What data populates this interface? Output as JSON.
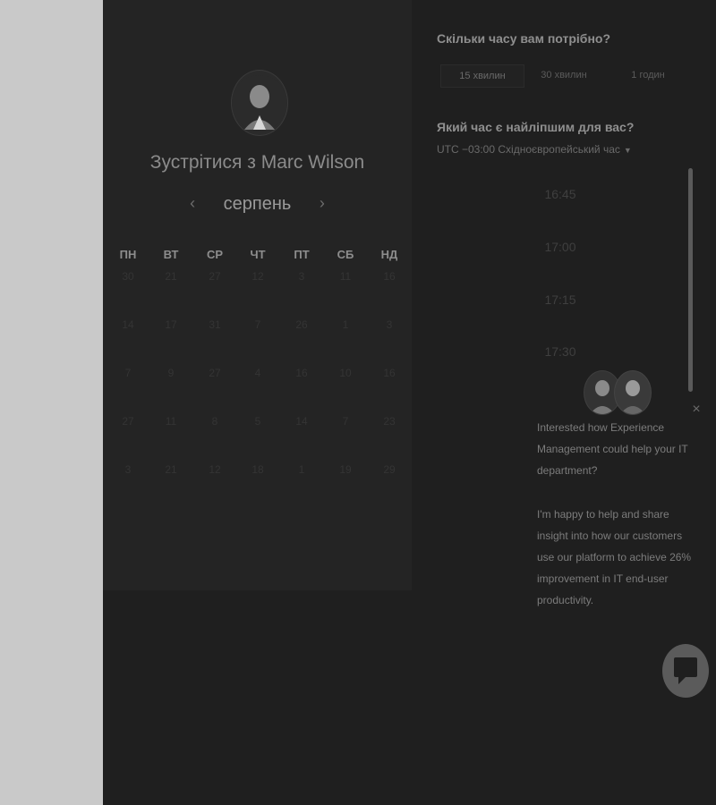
{
  "scheduler": {
    "title": "Зустрітися з Marc Wilson",
    "month": {
      "prev_icon": "‹",
      "label": "серпень",
      "next_icon": "›"
    },
    "weekdays": [
      "ПН",
      "ВТ",
      "СР",
      "ЧТ",
      "ПТ",
      "СБ",
      "НД"
    ],
    "weeks": [
      [
        "30",
        "21",
        "27",
        "12",
        "3",
        "11",
        "16"
      ],
      [
        "14",
        "17",
        "31",
        "7",
        "26",
        "1",
        "3"
      ],
      [
        "7",
        "9",
        "27",
        "4",
        "16",
        "10",
        "16"
      ],
      [
        "27",
        "11",
        "8",
        "5",
        "14",
        "7",
        "23"
      ],
      [
        "3",
        "21",
        "12",
        "18",
        "1",
        "19",
        "29"
      ]
    ]
  },
  "duration": {
    "question": "Скільки часу вам потрібно?",
    "options": [
      "15 хвилин",
      "30 хвилин",
      "1 годин"
    ],
    "selected": "15 хвилин"
  },
  "time": {
    "question": "Який час є найліпшим для вас?",
    "timezone": "UTC −03:00 Східноєвропейський час",
    "slots": [
      "16:45",
      "17:00",
      "17:15",
      "17:30"
    ]
  },
  "chat": {
    "close_icon": "×",
    "message_1": "Interested how Experience Management could help your IT department?",
    "message_2": "I'm happy to help and share insight into how our customers use our platform to achieve 26% improvement in IT end-user productivity."
  },
  "colors": {
    "page_bg": "#1f1f1f",
    "calendar_bg": "#242424",
    "side_bg": "#c9c9c9"
  },
  "icons": {
    "prev": "chevron-left-icon",
    "next": "chevron-right-icon",
    "caret": "caret-down-icon",
    "close": "close-icon",
    "chat": "chat-bubble-icon"
  }
}
